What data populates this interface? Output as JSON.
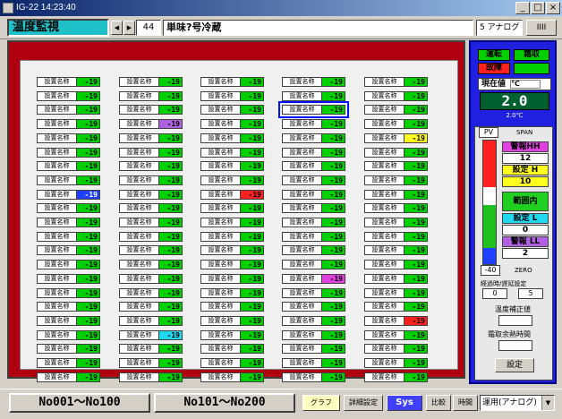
{
  "window": {
    "title": "IG-22 14:23:40",
    "min": "_",
    "max": "□",
    "close": "×"
  },
  "toolbar": {
    "title": "温度監視",
    "prev": "◀",
    "next": "▶",
    "number": "44",
    "name": "単味?号冷蔵",
    "mode": "5 アナログ",
    "bars": "IIII"
  },
  "cell_label": "設置名称",
  "grid_columns": 5,
  "grid_rows": 22,
  "colors": {
    "normal": "#00d000",
    "purple": "#b060e0",
    "blue": "#2040ff",
    "red": "#ff2020",
    "magenta": "#e040e0",
    "cyan": "#20d8f0",
    "yellow": "#ffff20"
  },
  "cells": [
    [
      "-19",
      "-19",
      "-19",
      "-19",
      "-19"
    ],
    [
      "-19",
      "-19",
      "-19",
      "-19",
      "-19"
    ],
    [
      "-19",
      "-19",
      "-19",
      "-19",
      "-19"
    ],
    [
      "-19",
      "-19",
      "-19",
      "-19",
      "-19"
    ],
    [
      "-19",
      "-19",
      "-19",
      "-19",
      "-19"
    ],
    [
      "-19",
      "-19",
      "-19",
      "-19",
      "-19"
    ],
    [
      "-19",
      "-19",
      "-19",
      "-19",
      "-19"
    ],
    [
      "-19",
      "-19",
      "-19",
      "-19",
      "-19"
    ],
    [
      "-19",
      "-19",
      "-19",
      "-19",
      "-19"
    ],
    [
      "-19",
      "-19",
      "-19",
      "-19",
      "-19"
    ],
    [
      "-19",
      "-19",
      "-19",
      "-19",
      "-19"
    ],
    [
      "-19",
      "-19",
      "-19",
      "-19",
      "-19"
    ],
    [
      "-19",
      "-19",
      "-19",
      "-19",
      "-19"
    ],
    [
      "-19",
      "-19",
      "-19",
      "-19",
      "-19"
    ],
    [
      "-19",
      "-19",
      "-19",
      "-19",
      "-19"
    ],
    [
      "-19",
      "-19",
      "-19",
      "-19",
      "-19"
    ],
    [
      "-19",
      "-19",
      "-19",
      "-19",
      "-19"
    ],
    [
      "-19",
      "-19",
      "-19",
      "-19",
      "-19"
    ],
    [
      "-19",
      "-19",
      "-19",
      "-19",
      "-19"
    ],
    [
      "-19",
      "-19",
      "-19",
      "-19",
      "-19"
    ],
    [
      "-19",
      "-19",
      "-19",
      "-19",
      "-19"
    ],
    [
      "-19",
      "-19",
      "-19",
      "-19",
      "-19"
    ]
  ],
  "special_cells": [
    {
      "row": 3,
      "col": 1,
      "status": "purple"
    },
    {
      "row": 4,
      "col": 4,
      "status": "yellow"
    },
    {
      "row": 8,
      "col": 0,
      "status": "blue"
    },
    {
      "row": 8,
      "col": 2,
      "status": "red"
    },
    {
      "row": 14,
      "col": 3,
      "status": "magenta"
    },
    {
      "row": 17,
      "col": 4,
      "status": "red"
    },
    {
      "row": 18,
      "col": 1,
      "status": "cyan"
    }
  ],
  "selected_cell": {
    "row": 2,
    "col": 3
  },
  "panel": {
    "run": "運転",
    "frost": "霜取",
    "fault": "故障",
    "current_label": "現在値",
    "current_unit": "℃",
    "current_value": "2.0",
    "current_sub": "2.0℃",
    "pv_label": "PV",
    "span_label": "SPAN",
    "alarm_hh": "警報HH",
    "alarm_hh_val": "12",
    "set_h": "設定 H",
    "set_h_val": "10",
    "range_in": "範囲内",
    "set_l": "設定 L",
    "set_l_val": "0",
    "alarm_ll": "警報 LL",
    "alarm_ll_val": "2",
    "min_val": "-40",
    "zero_label": "ZERO",
    "delay_label": "経過時/遅延設定",
    "delay1": "0",
    "delay2": "5",
    "temp_correct": "温度補正値",
    "defrost_time": "霜取余熱時間",
    "set_button": "設定"
  },
  "bottom": {
    "range1": "No001～No100",
    "range2": "No101～No200",
    "graph": "グラフ",
    "detail": "詳細設定",
    "sys": "Sys",
    "compare": "比較",
    "history": "時間",
    "select": "運用(アナログ)",
    "dd": "▼"
  }
}
